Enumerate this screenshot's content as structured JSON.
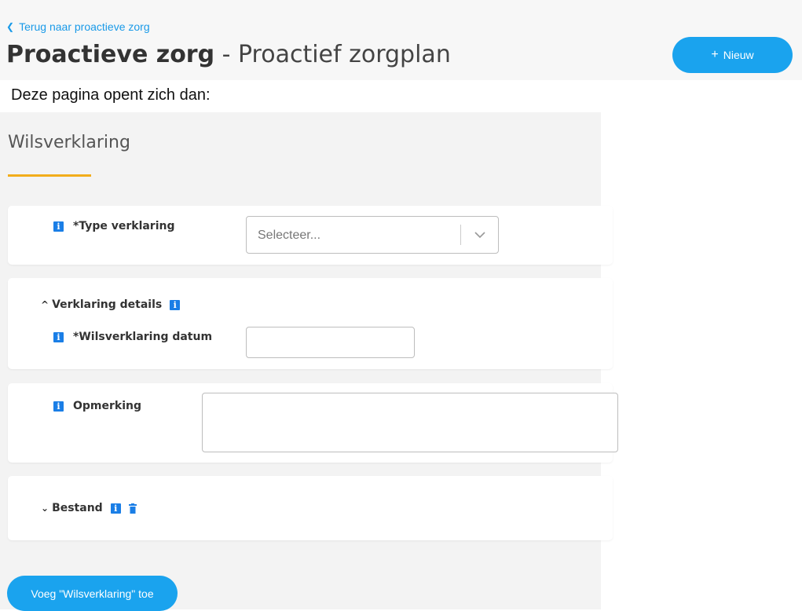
{
  "header": {
    "back_link": "Terug naar proactieve zorg",
    "title_bold": "Proactieve zorg",
    "title_sep": " - ",
    "title_rest": "Proactief zorgplan",
    "new_button": "Nieuw",
    "new_button_icon": "plus-icon"
  },
  "doc_text": "Deze pagina opent zich dan:",
  "form": {
    "section_title": "Wilsverklaring",
    "type_field": {
      "label": "*Type verklaring",
      "placeholder": "Selecteer..."
    },
    "details": {
      "header": "Verklaring details",
      "date_label": "*Wilsverklaring datum",
      "date_value": ""
    },
    "remark": {
      "label": "Opmerking",
      "value": ""
    },
    "file": {
      "header": "Bestand"
    },
    "add_button": "Voeg \"Wilsverklaring\" toe"
  },
  "colors": {
    "accent_blue": "#1aa3ee",
    "info_blue": "#1a7ee6",
    "underline_orange": "#f2ad1b"
  }
}
